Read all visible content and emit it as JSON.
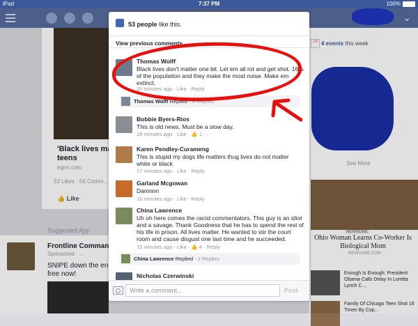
{
  "status_bar": {
    "device": "iPad",
    "time": "7:37 PM",
    "battery": "100%"
  },
  "background": {
    "headline": "'Black lives mat... teens",
    "headline_line1": "'Black lives mat",
    "headline_line2": "teens",
    "source": "egnn.com",
    "stats": "53 Likes · 56 Comm...",
    "like_label": "Like",
    "suggested_label": "Suggested App",
    "app_title": "Frontline Comman...",
    "app_sponsored": "Sponsored · ...",
    "app_desc_line1": "SNIPE down the en...",
    "app_desc_line2": "free now!",
    "events_date": "18",
    "events_count": "4 events",
    "events_suffix": " this week",
    "see_more": "See More",
    "news_tag": "NEWSONE",
    "news_headline": "Ohio Woman Learns Co-Worker Is Biological Mom",
    "news_source": "NEWSONE.COM",
    "news_items": [
      {
        "text": "Enough Is Enough: President Obama Calls Delay In Loretta Lynch C..."
      },
      {
        "text": "Family Of Chicago Teen Shot 16 Times By Cop..."
      }
    ]
  },
  "modal": {
    "likes_count": "53 people",
    "likes_suffix": " like this.",
    "view_previous": "View previous comments",
    "comments": [
      {
        "name": "Thomas Wolff",
        "text": "Black lives don't matter one bit. Let em all rot and get shot. 16% of the population and they make the most noise. Make em extinct.",
        "time": "20 minutes ago",
        "like": "Like",
        "reply": "Reply",
        "likes": "",
        "replies": {
          "who": "Thomas Wolff",
          "verb": " Replied",
          "count": "4 Replies"
        }
      },
      {
        "name": "Bobbie Byers-Rios",
        "text": "This is old news. Must be a slow day.",
        "time": "18 minutes ago",
        "like": "Like",
        "reply": "",
        "likes": "1",
        "replies": null
      },
      {
        "name": "Karen Pendley-Curameng",
        "text": "This is stupid my dogs life matters thug lives do not matter white or black",
        "time": "17 minutes ago",
        "like": "Like",
        "reply": "Reply",
        "likes": "",
        "replies": null
      },
      {
        "name": "Garland Mcgowan",
        "text": "Damnnn",
        "time": "16 minutes ago",
        "like": "Like",
        "reply": "Reply",
        "likes": "",
        "replies": null
      },
      {
        "name": "China Lawrence",
        "text": "Uh oh here comes the racist commentators. This guy is an idiot and a savage. Thank Goodness that he has to spend the rest of his life in prison. All lives matter. He wanted to stir the court room and cause disgust one last time and he succeeded.",
        "time": "15 minutes ago",
        "like": "Like",
        "reply": "",
        "likes": "4",
        "reply2": "Reply",
        "replies": {
          "who": "China Lawrence",
          "verb": " Replied",
          "count": "2 Replies"
        }
      },
      {
        "name": "Nicholas Czerwinski",
        "text": "",
        "time": "",
        "like": "",
        "reply": "",
        "likes": "",
        "replies": null
      }
    ],
    "composer": {
      "placeholder": "Write a comment...",
      "post_label": "Post"
    }
  },
  "colors": {
    "fb_blue": "#3b5998",
    "link_blue": "#4267b2",
    "annotation_red": "#e8100f",
    "scribble_blue": "#1a2fa8"
  }
}
